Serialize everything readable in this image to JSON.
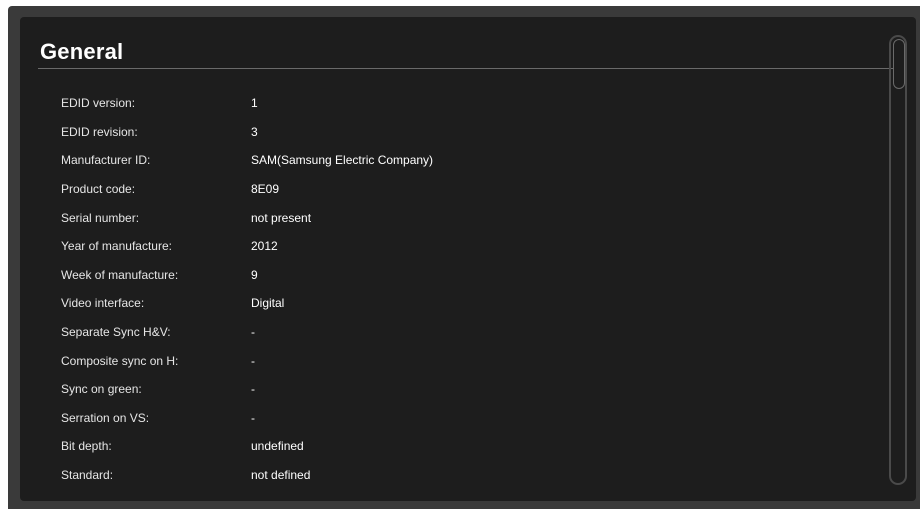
{
  "section": {
    "title": "General"
  },
  "properties": [
    {
      "label": "EDID version:",
      "value": "1"
    },
    {
      "label": "EDID revision:",
      "value": "3"
    },
    {
      "label": "Manufacturer ID:",
      "value": "SAM(Samsung Electric Company)"
    },
    {
      "label": "Product code:",
      "value": "8E09"
    },
    {
      "label": "Serial number:",
      "value": "not present"
    },
    {
      "label": "Year of manufacture:",
      "value": "2012"
    },
    {
      "label": "Week of manufacture:",
      "value": "9"
    },
    {
      "label": "Video interface:",
      "value": "Digital"
    },
    {
      "label": "Separate Sync H&V:",
      "value": "-"
    },
    {
      "label": "Composite sync on H:",
      "value": "-"
    },
    {
      "label": "Sync on green:",
      "value": "-"
    },
    {
      "label": "Serration on VS:",
      "value": "-"
    },
    {
      "label": "Bit depth:",
      "value": "undefined"
    },
    {
      "label": "Standard:",
      "value": "not defined"
    }
  ],
  "colors": {
    "frame": "#3a3a3a",
    "panel": "#1d1d1d",
    "text": "#ffffff"
  }
}
